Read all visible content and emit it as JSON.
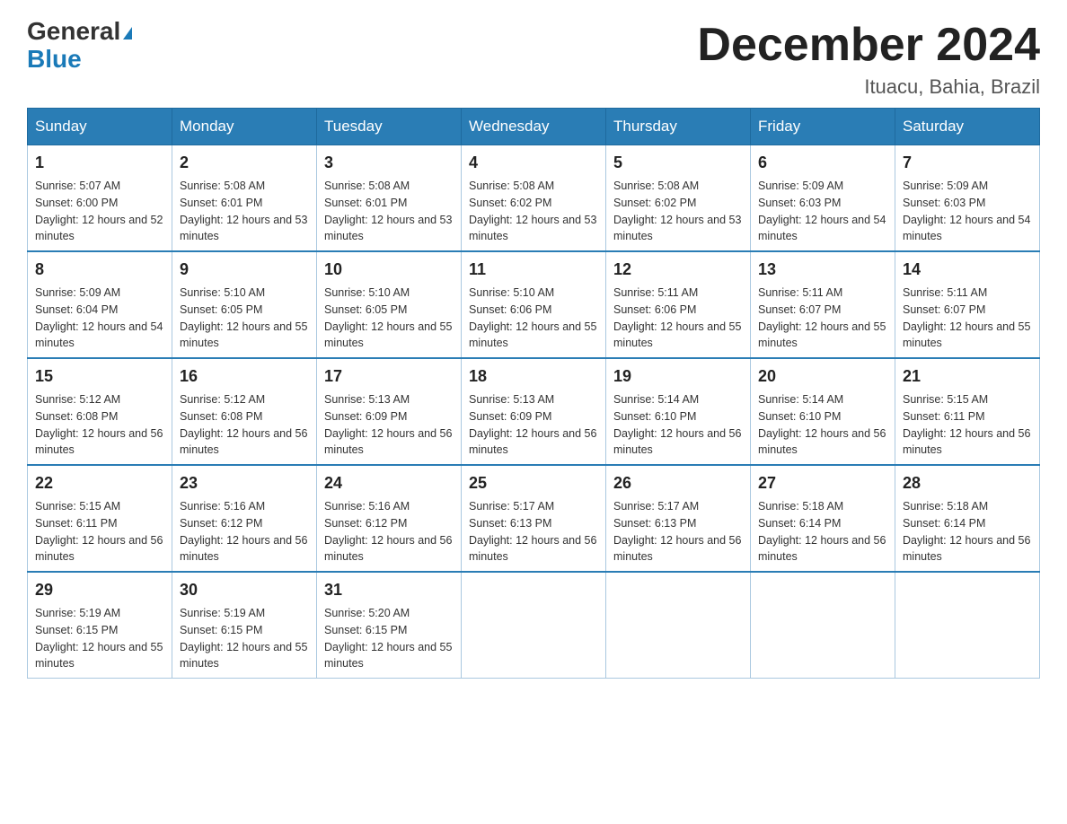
{
  "header": {
    "logo_line1": "General",
    "logo_line2": "Blue",
    "month_title": "December 2024",
    "location": "Ituacu, Bahia, Brazil"
  },
  "days_of_week": [
    "Sunday",
    "Monday",
    "Tuesday",
    "Wednesday",
    "Thursday",
    "Friday",
    "Saturday"
  ],
  "weeks": [
    [
      {
        "day": "1",
        "sunrise": "5:07 AM",
        "sunset": "6:00 PM",
        "daylight": "12 hours and 52 minutes."
      },
      {
        "day": "2",
        "sunrise": "5:08 AM",
        "sunset": "6:01 PM",
        "daylight": "12 hours and 53 minutes."
      },
      {
        "day": "3",
        "sunrise": "5:08 AM",
        "sunset": "6:01 PM",
        "daylight": "12 hours and 53 minutes."
      },
      {
        "day": "4",
        "sunrise": "5:08 AM",
        "sunset": "6:02 PM",
        "daylight": "12 hours and 53 minutes."
      },
      {
        "day": "5",
        "sunrise": "5:08 AM",
        "sunset": "6:02 PM",
        "daylight": "12 hours and 53 minutes."
      },
      {
        "day": "6",
        "sunrise": "5:09 AM",
        "sunset": "6:03 PM",
        "daylight": "12 hours and 54 minutes."
      },
      {
        "day": "7",
        "sunrise": "5:09 AM",
        "sunset": "6:03 PM",
        "daylight": "12 hours and 54 minutes."
      }
    ],
    [
      {
        "day": "8",
        "sunrise": "5:09 AM",
        "sunset": "6:04 PM",
        "daylight": "12 hours and 54 minutes."
      },
      {
        "day": "9",
        "sunrise": "5:10 AM",
        "sunset": "6:05 PM",
        "daylight": "12 hours and 55 minutes."
      },
      {
        "day": "10",
        "sunrise": "5:10 AM",
        "sunset": "6:05 PM",
        "daylight": "12 hours and 55 minutes."
      },
      {
        "day": "11",
        "sunrise": "5:10 AM",
        "sunset": "6:06 PM",
        "daylight": "12 hours and 55 minutes."
      },
      {
        "day": "12",
        "sunrise": "5:11 AM",
        "sunset": "6:06 PM",
        "daylight": "12 hours and 55 minutes."
      },
      {
        "day": "13",
        "sunrise": "5:11 AM",
        "sunset": "6:07 PM",
        "daylight": "12 hours and 55 minutes."
      },
      {
        "day": "14",
        "sunrise": "5:11 AM",
        "sunset": "6:07 PM",
        "daylight": "12 hours and 55 minutes."
      }
    ],
    [
      {
        "day": "15",
        "sunrise": "5:12 AM",
        "sunset": "6:08 PM",
        "daylight": "12 hours and 56 minutes."
      },
      {
        "day": "16",
        "sunrise": "5:12 AM",
        "sunset": "6:08 PM",
        "daylight": "12 hours and 56 minutes."
      },
      {
        "day": "17",
        "sunrise": "5:13 AM",
        "sunset": "6:09 PM",
        "daylight": "12 hours and 56 minutes."
      },
      {
        "day": "18",
        "sunrise": "5:13 AM",
        "sunset": "6:09 PM",
        "daylight": "12 hours and 56 minutes."
      },
      {
        "day": "19",
        "sunrise": "5:14 AM",
        "sunset": "6:10 PM",
        "daylight": "12 hours and 56 minutes."
      },
      {
        "day": "20",
        "sunrise": "5:14 AM",
        "sunset": "6:10 PM",
        "daylight": "12 hours and 56 minutes."
      },
      {
        "day": "21",
        "sunrise": "5:15 AM",
        "sunset": "6:11 PM",
        "daylight": "12 hours and 56 minutes."
      }
    ],
    [
      {
        "day": "22",
        "sunrise": "5:15 AM",
        "sunset": "6:11 PM",
        "daylight": "12 hours and 56 minutes."
      },
      {
        "day": "23",
        "sunrise": "5:16 AM",
        "sunset": "6:12 PM",
        "daylight": "12 hours and 56 minutes."
      },
      {
        "day": "24",
        "sunrise": "5:16 AM",
        "sunset": "6:12 PM",
        "daylight": "12 hours and 56 minutes."
      },
      {
        "day": "25",
        "sunrise": "5:17 AM",
        "sunset": "6:13 PM",
        "daylight": "12 hours and 56 minutes."
      },
      {
        "day": "26",
        "sunrise": "5:17 AM",
        "sunset": "6:13 PM",
        "daylight": "12 hours and 56 minutes."
      },
      {
        "day": "27",
        "sunrise": "5:18 AM",
        "sunset": "6:14 PM",
        "daylight": "12 hours and 56 minutes."
      },
      {
        "day": "28",
        "sunrise": "5:18 AM",
        "sunset": "6:14 PM",
        "daylight": "12 hours and 56 minutes."
      }
    ],
    [
      {
        "day": "29",
        "sunrise": "5:19 AM",
        "sunset": "6:15 PM",
        "daylight": "12 hours and 55 minutes."
      },
      {
        "day": "30",
        "sunrise": "5:19 AM",
        "sunset": "6:15 PM",
        "daylight": "12 hours and 55 minutes."
      },
      {
        "day": "31",
        "sunrise": "5:20 AM",
        "sunset": "6:15 PM",
        "daylight": "12 hours and 55 minutes."
      },
      null,
      null,
      null,
      null
    ]
  ]
}
